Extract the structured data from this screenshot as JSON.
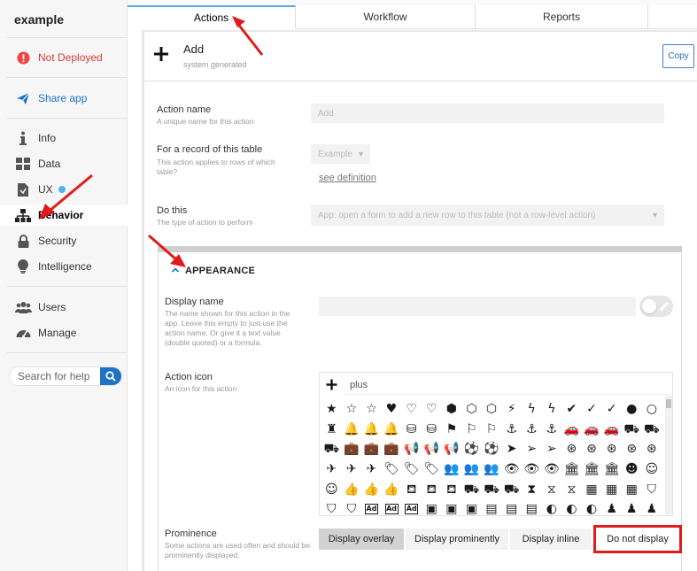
{
  "app": {
    "name": "example"
  },
  "sidebar": {
    "deploy_status": "Not Deployed",
    "share": "Share app",
    "items": [
      {
        "label": "Info",
        "icon": "info-icon"
      },
      {
        "label": "Data",
        "icon": "grid-icon"
      },
      {
        "label": "UX",
        "icon": "ux-icon"
      },
      {
        "label": "Behavior",
        "icon": "sitemap-icon"
      },
      {
        "label": "Security",
        "icon": "lock-icon"
      },
      {
        "label": "Intelligence",
        "icon": "lightbulb-icon"
      }
    ],
    "items2": [
      {
        "label": "Users",
        "icon": "users-icon"
      },
      {
        "label": "Manage",
        "icon": "dashboard-icon"
      }
    ],
    "search_placeholder": "Search for help"
  },
  "tabs": [
    {
      "label": "Actions",
      "active": true
    },
    {
      "label": "Workflow",
      "active": false
    },
    {
      "label": "Reports",
      "active": false
    }
  ],
  "action": {
    "title": "Add",
    "subtitle": "system generated",
    "copy_label": "Copy"
  },
  "form": {
    "action_name": {
      "label": "Action name",
      "hint": "A unique name for this action",
      "placeholder": "Add"
    },
    "table": {
      "label": "For a record of this table",
      "hint": "This action applies to rows of which table?",
      "value": "Example",
      "link": "see definition"
    },
    "do_this": {
      "label": "Do this",
      "hint": "The type of action to perform",
      "value": "App: open a form to add a new row to this table (not a row-level action)"
    }
  },
  "appearance": {
    "section_title": "APPEARANCE",
    "display_name": {
      "label": "Display name",
      "hint": "The name shown for this action in the app. Leave this empty to just use the action name. Or give it a text value (double quoted) or a formula."
    },
    "action_icon": {
      "label": "Action icon",
      "hint": "An icon for this action",
      "search_value": "plus"
    },
    "icon_rows": [
      [
        "★",
        "☆",
        "☆",
        "♥",
        "♡",
        "♡",
        "⬢",
        "⬡",
        "⬡",
        "⚡",
        "ϟ",
        "ϟ",
        "✔",
        "✓",
        "✓",
        "●",
        "○"
      ],
      [
        "♜",
        "🔔",
        "🔔",
        "🔔",
        "⛁",
        "⛁",
        "⚑",
        "⚐",
        "⚐",
        "⚓",
        "⚓",
        "⚓",
        "🚗",
        "🚗",
        "🚗",
        "⛟",
        "⛟"
      ],
      [
        "⛟",
        "💼",
        "💼",
        "💼",
        "📢",
        "📢",
        "📢",
        "⚽",
        "⚽",
        "➤",
        "➢",
        "➢",
        "⊛",
        "⊛",
        "⊛",
        "⊛",
        "⊛"
      ],
      [
        "✈",
        "✈",
        "✈",
        "🏷",
        "🏷",
        "🏷",
        "👥",
        "👥",
        "👥",
        "👁",
        "👁",
        "👁",
        "🏛",
        "🏛",
        "🏛",
        "☻",
        "☺"
      ],
      [
        "☺",
        "👍",
        "👍",
        "👍",
        "⛾",
        "⛾",
        "⛾",
        "⛟",
        "⛟",
        "⛟",
        "⧗",
        "⧖",
        "⧖",
        "▦",
        "▦",
        "▦",
        "⛉"
      ],
      [
        "⛉",
        "⛉",
        "Ad",
        "Ad",
        "Ad",
        "▣",
        "▣",
        "▣",
        "▤",
        "▤",
        "▤",
        "◐",
        "◐",
        "◐",
        "♟",
        "♟",
        "♟"
      ]
    ],
    "prominence": {
      "label": "Prominence",
      "hint": "Some actions are used often and should be prominently displayed.",
      "options": [
        "Display overlay",
        "Display prominently",
        "Display inline",
        "Do not display"
      ],
      "selected": "Display overlay"
    }
  },
  "colors": {
    "accent": "#1e73c7",
    "annotation": "#e01b1b",
    "warning": "#d63a3a"
  }
}
